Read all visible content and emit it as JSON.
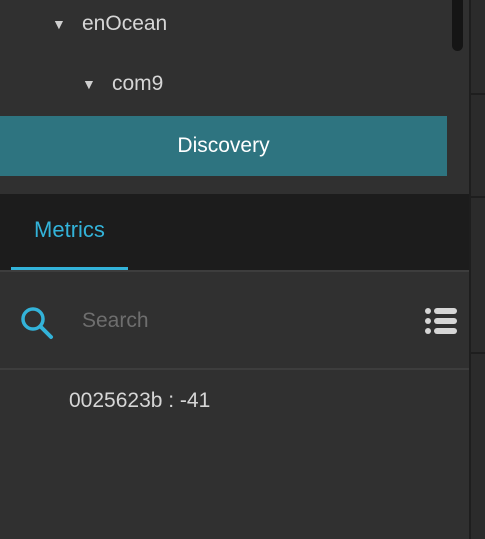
{
  "tree": {
    "items": [
      {
        "label": "enOcean",
        "caret": "▼"
      },
      {
        "label": "com9",
        "caret": "▼"
      }
    ]
  },
  "discovery_label": "Discovery",
  "tabs": [
    {
      "label": "Metrics",
      "active": true
    }
  ],
  "search": {
    "placeholder": "Search",
    "value": ""
  },
  "metrics_list": [
    {
      "text": "0025623b : -41"
    }
  ],
  "colors": {
    "accent": "#33b3d9",
    "discovery_bg": "#2e7480"
  },
  "icons": {
    "search": "search-icon",
    "list": "list-icon",
    "caret": "caret-down-icon"
  }
}
